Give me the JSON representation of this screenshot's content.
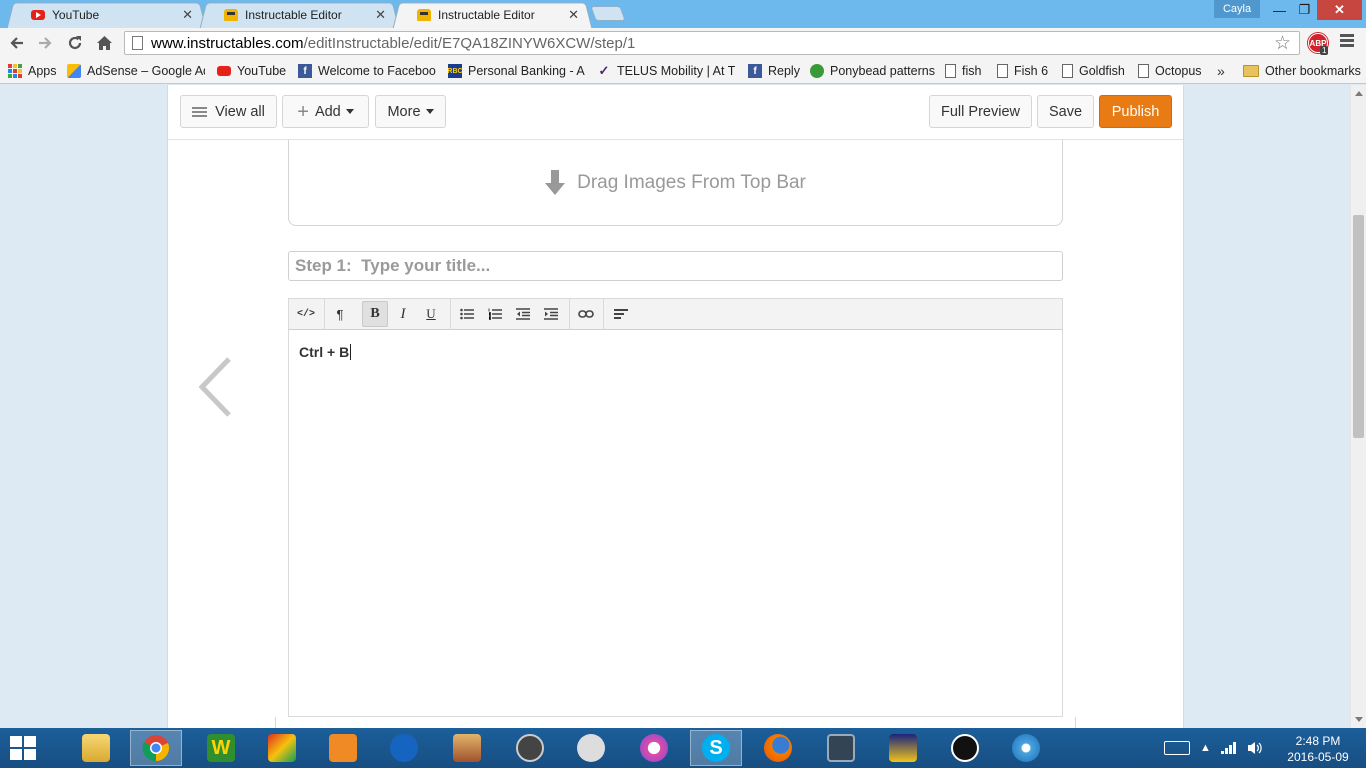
{
  "browser": {
    "tabs": [
      {
        "title": "YouTube",
        "favicon": "youtube-icon",
        "active": false
      },
      {
        "title": "Instructable Editor",
        "favicon": "instructables-robot-icon",
        "active": false
      },
      {
        "title": "Instructable Editor",
        "favicon": "instructables-robot-icon",
        "active": true
      }
    ],
    "user": "Cayla",
    "address": {
      "host": "www.instructables.com",
      "path": "/editInstructable/edit/E7QA18ZINYW6XCW/step/1"
    },
    "adblock_label": "ABP",
    "adblock_count": "1",
    "bookmarks": [
      {
        "label": "Apps",
        "icon": "apps-grid-icon"
      },
      {
        "label": "AdSense – Google Ad",
        "icon": "adsense-icon"
      },
      {
        "label": "YouTube",
        "icon": "youtube-icon"
      },
      {
        "label": "Welcome to Faceboo",
        "icon": "facebook-icon"
      },
      {
        "label": "Personal Banking - Ac",
        "icon": "rbc-icon"
      },
      {
        "label": "TELUS Mobility | At TE",
        "icon": "telus-icon"
      },
      {
        "label": "Reply",
        "icon": "facebook-icon"
      },
      {
        "label": "Ponybead patterns",
        "icon": "ponybead-icon"
      },
      {
        "label": "fish",
        "icon": "page-icon"
      },
      {
        "label": "Fish 6",
        "icon": "page-icon"
      },
      {
        "label": "Goldfish",
        "icon": "page-icon"
      },
      {
        "label": "Octopus",
        "icon": "page-icon"
      }
    ],
    "bookmarks_overflow": "»",
    "other_bookmarks": "Other bookmarks"
  },
  "editor": {
    "toolbar": {
      "view_all": "View all",
      "add": "Add",
      "more": "More",
      "full_preview": "Full Preview",
      "save": "Save",
      "publish": "Publish"
    },
    "drop_zone": "Drag Images From Top Bar",
    "title_placeholder": "Step 1:  Type your title...",
    "rte_buttons": [
      "code-view",
      "paragraph-format",
      "bold",
      "italic",
      "underline",
      "bulleted-list",
      "numbered-list",
      "outdent",
      "indent",
      "insert-link",
      "align"
    ],
    "rte_labels": {
      "code": "</>",
      "paragraph": "¶",
      "bold": "B",
      "italic": "I",
      "underline": "U"
    },
    "body_text": "Ctrl + B",
    "colors": {
      "publish": "#e87b13",
      "page_bg": "#dde9f3"
    }
  },
  "taskbar": {
    "apps": [
      "file-explorer-icon",
      "chrome-icon",
      "wordweb-icon",
      "photo-app-icon",
      "media-player-icon",
      "malwarebytes-icon",
      "boat-app-icon",
      "video-editor-icon",
      "webcam-app-icon",
      "itunes-icon",
      "skype-icon",
      "firefox-icon",
      "network-camera-icon",
      "cheese-app-icon",
      "play-app-icon",
      "safari-icon"
    ],
    "time": "2:48 PM",
    "date": "2016-05-09"
  }
}
